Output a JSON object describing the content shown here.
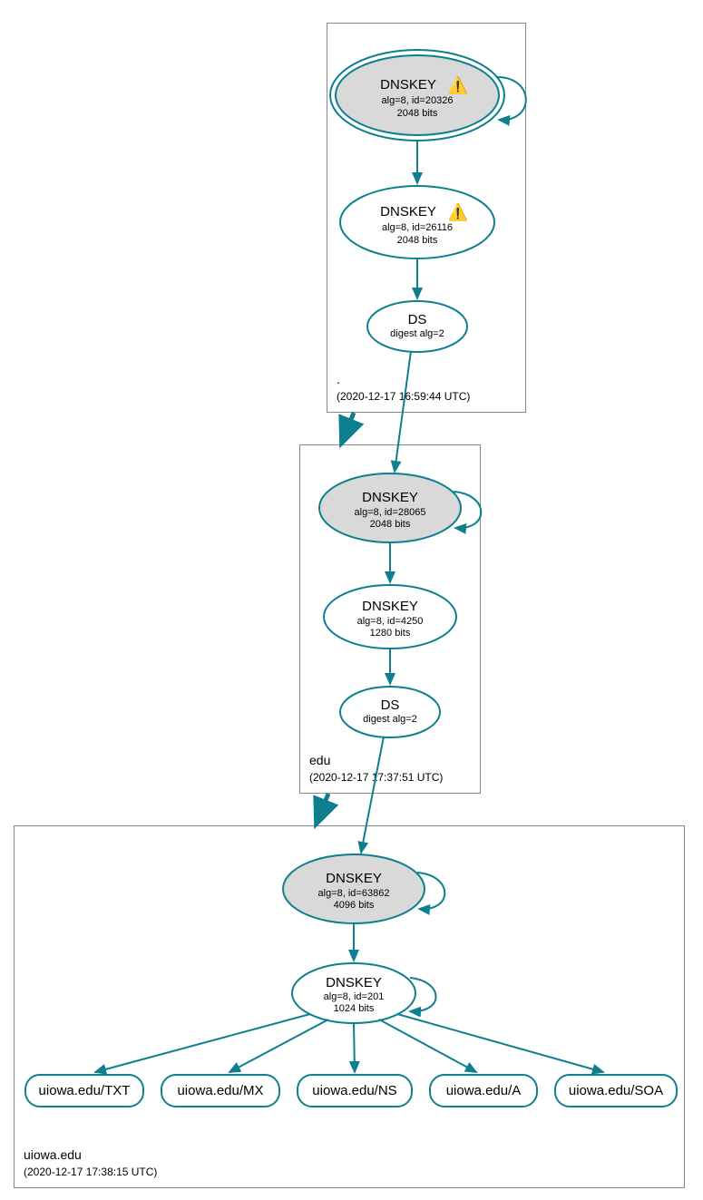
{
  "zones": {
    "root": {
      "label": ".",
      "timestamp": "(2020-12-17 16:59:44 UTC)"
    },
    "edu": {
      "label": "edu",
      "timestamp": "(2020-12-17 17:37:51 UTC)"
    },
    "uiowa": {
      "label": "uiowa.edu",
      "timestamp": "(2020-12-17 17:38:15 UTC)"
    }
  },
  "nodes": {
    "root_ksk": {
      "title": "DNSKEY",
      "line2": "alg=8, id=20326",
      "line3": "2048 bits",
      "warn": "⚠️"
    },
    "root_zsk": {
      "title": "DNSKEY",
      "line2": "alg=8, id=26116",
      "line3": "2048 bits",
      "warn": "⚠️"
    },
    "root_ds": {
      "title": "DS",
      "line2": "digest alg=2"
    },
    "edu_ksk": {
      "title": "DNSKEY",
      "line2": "alg=8, id=28065",
      "line3": "2048 bits"
    },
    "edu_zsk": {
      "title": "DNSKEY",
      "line2": "alg=8, id=4250",
      "line3": "1280 bits"
    },
    "edu_ds": {
      "title": "DS",
      "line2": "digest alg=2"
    },
    "uiowa_ksk": {
      "title": "DNSKEY",
      "line2": "alg=8, id=63862",
      "line3": "4096 bits"
    },
    "uiowa_zsk": {
      "title": "DNSKEY",
      "line2": "alg=8, id=201",
      "line3": "1024 bits"
    }
  },
  "records": {
    "txt": "uiowa.edu/TXT",
    "mx": "uiowa.edu/MX",
    "ns": "uiowa.edu/NS",
    "a": "uiowa.edu/A",
    "soa": "uiowa.edu/SOA"
  }
}
